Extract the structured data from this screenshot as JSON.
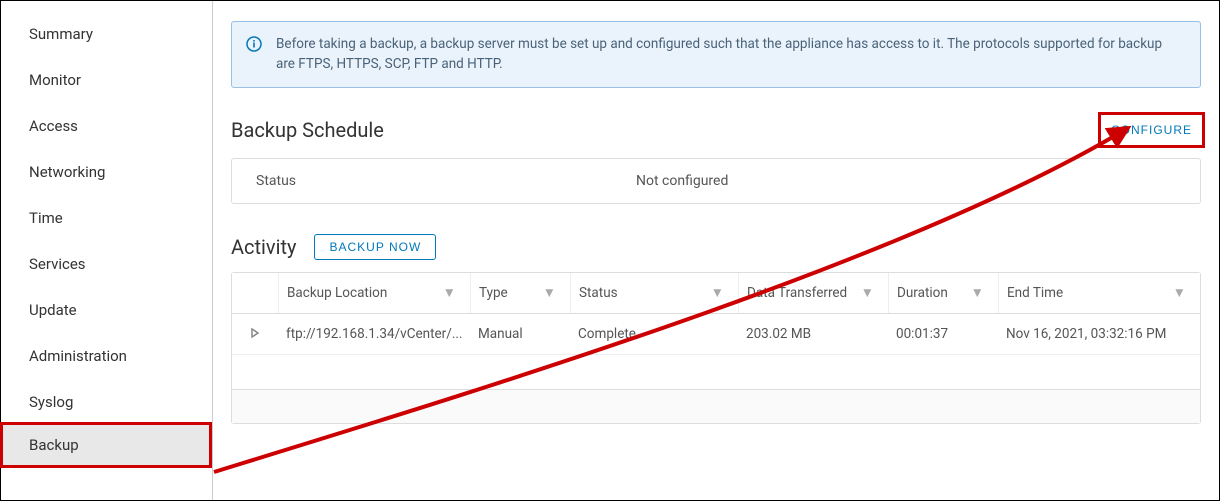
{
  "sidebar": {
    "items": [
      {
        "label": "Summary",
        "active": false
      },
      {
        "label": "Monitor",
        "active": false
      },
      {
        "label": "Access",
        "active": false
      },
      {
        "label": "Networking",
        "active": false
      },
      {
        "label": "Time",
        "active": false
      },
      {
        "label": "Services",
        "active": false
      },
      {
        "label": "Update",
        "active": false
      },
      {
        "label": "Administration",
        "active": false
      },
      {
        "label": "Syslog",
        "active": false
      },
      {
        "label": "Backup",
        "active": true
      }
    ]
  },
  "banner": {
    "text": "Before taking a backup, a backup server must be set up and configured such that the appliance has access to it. The protocols supported for backup are FTPS, HTTPS, SCP, FTP and HTTP."
  },
  "schedule": {
    "title": "Backup Schedule",
    "configure_label": "CONFIGURE",
    "status_label": "Status",
    "status_value": "Not configured"
  },
  "activity": {
    "title": "Activity",
    "backup_now_label": "BACKUP NOW",
    "columns": {
      "location": "Backup Location",
      "type": "Type",
      "status": "Status",
      "data": "Data Transferred",
      "duration": "Duration",
      "end": "End Time"
    },
    "rows": [
      {
        "location": "ftp://192.168.1.34/vCenter/...",
        "type": "Manual",
        "status": "Complete",
        "data": "203.02 MB",
        "duration": "00:01:37",
        "end": "Nov 16, 2021, 03:32:16 PM"
      }
    ]
  }
}
